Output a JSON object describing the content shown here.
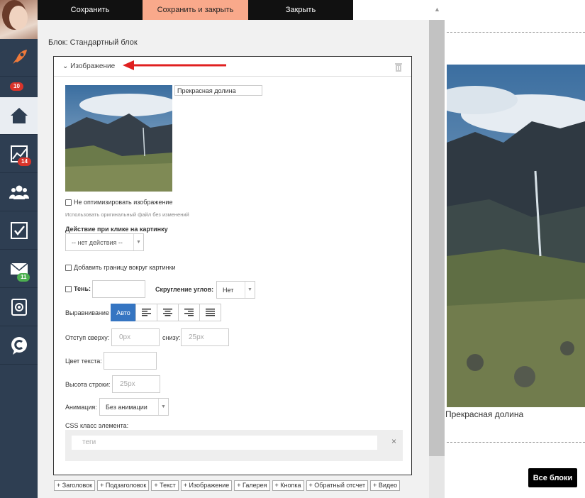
{
  "toolbar": {
    "save": "Сохранить",
    "save_close": "Сохранить и закрыть",
    "close": "Закрыть"
  },
  "sidebar": {
    "items": [
      {
        "icon": "rocket-icon",
        "badge": ""
      },
      {
        "icon": "home-icon",
        "badge": "10"
      },
      {
        "icon": "chart-icon",
        "badge": "14"
      },
      {
        "icon": "users-icon",
        "badge": ""
      },
      {
        "icon": "checkbox-icon",
        "badge": ""
      },
      {
        "icon": "mail-icon",
        "badge": "11"
      },
      {
        "icon": "settings-icon",
        "badge": ""
      },
      {
        "icon": "logo-c-icon",
        "badge": ""
      }
    ]
  },
  "editor": {
    "block_label": "Блок: Стандартный блок",
    "section_title": "Изображение",
    "caption_value": "Прекрасная долина",
    "no_optimize_label": "Не оптимизировать изображение",
    "no_optimize_hint": "Использовать оригинальный файл без изменений",
    "click_action_label": "Действие при клике на картинку",
    "click_action_value": "-- нет действия --",
    "border_label": "Добавить границу вокруг картинки",
    "shadow_label": "Тень:",
    "radius_label": "Скругление углов:",
    "radius_value": "Нет",
    "align_label": "Выравнивание",
    "align_auto": "Авто",
    "margin_top_label": "Отступ сверху:",
    "margin_top_placeholder": "0px",
    "margin_bottom_label": "снизу:",
    "margin_bottom_placeholder": "25px",
    "text_color_label": "Цвет текста:",
    "line_height_label": "Высота строки:",
    "line_height_placeholder": "25px",
    "animation_label": "Анимация:",
    "animation_value": "Без анимации",
    "css_class_label": "CSS класс элемента:",
    "tags_placeholder": "теги"
  },
  "add_buttons": [
    "+ Заголовок",
    "+ Подзаголовок",
    "+ Текст",
    "+ Изображение",
    "+ Галерея",
    "+ Кнопка",
    "+ Обратный отсчет",
    "+ Видео"
  ],
  "preview": {
    "caption": "Прекрасная долина",
    "all_blocks": "Все блоки"
  },
  "colors": {
    "sidebar": "#2e3e52",
    "accent_button": "#f9a98b",
    "align_active": "#3575c2",
    "arrow": "#e02020"
  }
}
